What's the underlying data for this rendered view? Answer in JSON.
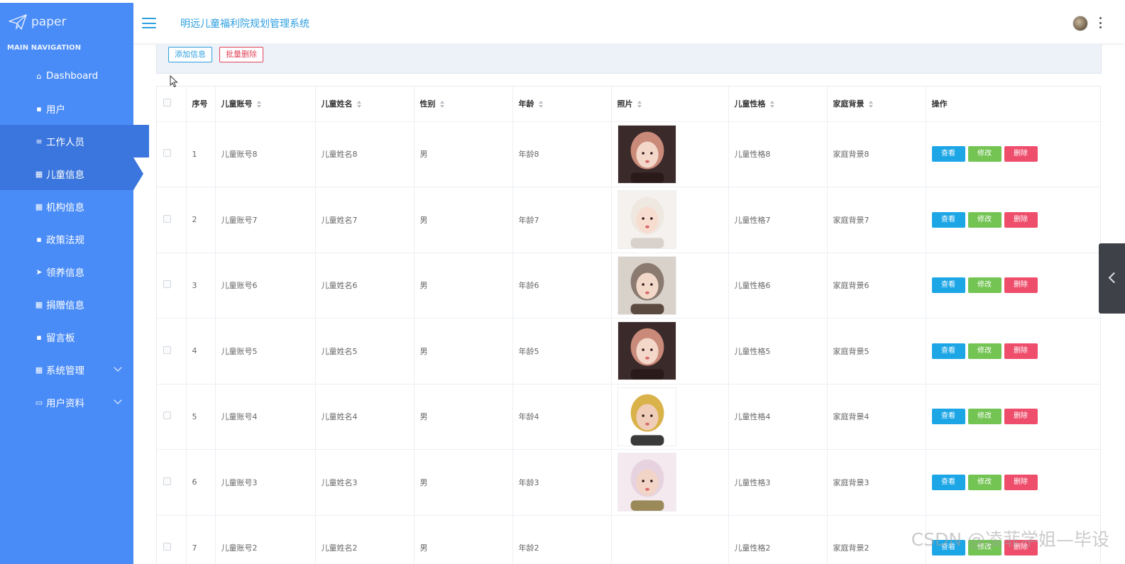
{
  "brand": {
    "logo_text": "paper",
    "logo_icon": "paper-plane-icon"
  },
  "header": {
    "title": "明远儿童福利院规划管理系统",
    "menu_icon": "hamburger-icon",
    "avatar": "user-avatar",
    "more_icon": "kebab-icon"
  },
  "sidebar": {
    "heading": "MAIN NAVIGATION",
    "items": [
      {
        "label": "Dashboard",
        "icon": "home-icon",
        "glyph": "⌂"
      },
      {
        "label": "用户",
        "icon": "comment-icon",
        "glyph": "▪"
      },
      {
        "label": "工作人员",
        "icon": "list-icon",
        "glyph": "≡"
      },
      {
        "label": "儿童信息",
        "icon": "grid-icon",
        "glyph": "▦"
      },
      {
        "label": "机构信息",
        "icon": "table-icon",
        "glyph": "▦"
      },
      {
        "label": "政策法规",
        "icon": "comment-icon",
        "glyph": "▪"
      },
      {
        "label": "领养信息",
        "icon": "send-icon",
        "glyph": "➤"
      },
      {
        "label": "捐赠信息",
        "icon": "grid-icon",
        "glyph": "▦"
      },
      {
        "label": "留言板",
        "icon": "clipboard-icon",
        "glyph": "▪"
      },
      {
        "label": "系统管理",
        "icon": "grid-icon",
        "glyph": "▦"
      },
      {
        "label": "用户资料",
        "icon": "calendar-icon",
        "glyph": "▭"
      }
    ]
  },
  "toolbar": {
    "add_label": "添加信息",
    "batch_delete_label": "批量删除"
  },
  "table": {
    "columns": [
      "序号",
      "儿童账号",
      "儿童姓名",
      "性别",
      "年龄",
      "照片",
      "儿童性格",
      "家庭背景",
      "操作"
    ],
    "rows": [
      {
        "no": "1",
        "account": "儿童账号8",
        "name": "儿童姓名8",
        "gender": "男",
        "age": "年龄8",
        "personality": "儿童性格8",
        "background": "家庭背景8"
      },
      {
        "no": "2",
        "account": "儿童账号7",
        "name": "儿童姓名7",
        "gender": "男",
        "age": "年龄7",
        "personality": "儿童性格7",
        "background": "家庭背景7"
      },
      {
        "no": "3",
        "account": "儿童账号6",
        "name": "儿童姓名6",
        "gender": "男",
        "age": "年龄6",
        "personality": "儿童性格6",
        "background": "家庭背景6"
      },
      {
        "no": "4",
        "account": "儿童账号5",
        "name": "儿童姓名5",
        "gender": "男",
        "age": "年龄5",
        "personality": "儿童性格5",
        "background": "家庭背景5"
      },
      {
        "no": "5",
        "account": "儿童账号4",
        "name": "儿童姓名4",
        "gender": "男",
        "age": "年龄4",
        "personality": "儿童性格4",
        "background": "家庭背景4"
      },
      {
        "no": "6",
        "account": "儿童账号3",
        "name": "儿童姓名3",
        "gender": "男",
        "age": "年龄3",
        "personality": "儿童性格3",
        "background": "家庭背景3"
      },
      {
        "no": "7",
        "account": "儿童账号2",
        "name": "儿童姓名2",
        "gender": "男",
        "age": "年龄2",
        "personality": "儿童性格2",
        "background": "家庭背景2"
      }
    ],
    "actions": {
      "view": "查看",
      "edit": "修改",
      "delete": "删除"
    }
  },
  "watermark": "CSDN @凌菲学姐—毕设",
  "colors": {
    "sidebar": "#4a8cf7",
    "sidebar_active": "#3a76dd",
    "accent": "#2d9fe0",
    "view": "#1ca6e6",
    "edit": "#74c454",
    "delete": "#ee4e6b"
  }
}
